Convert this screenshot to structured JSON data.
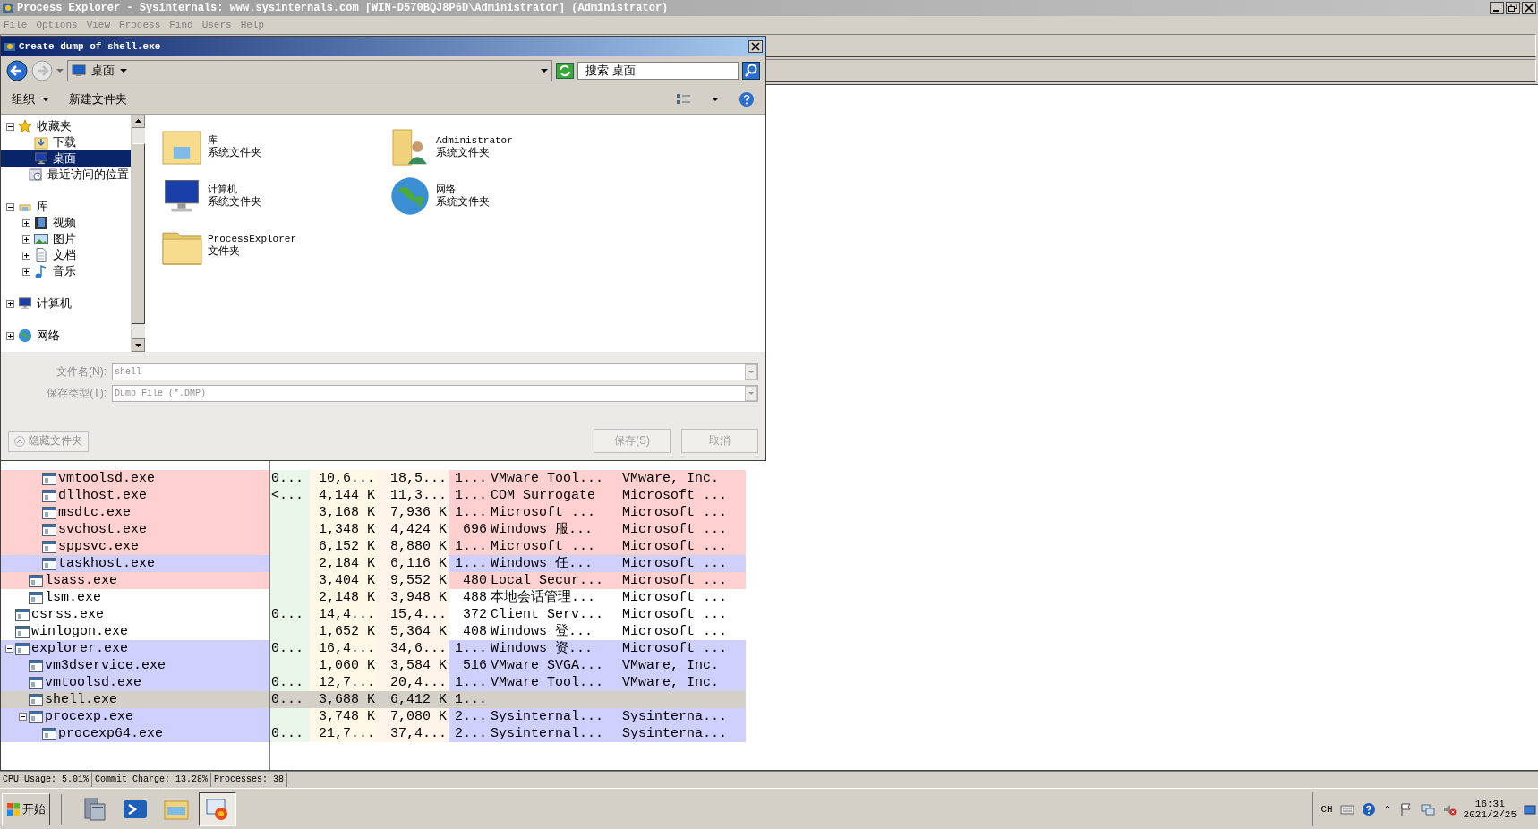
{
  "window": {
    "title": "Process Explorer - Sysinternals: www.sysinternals.com [WIN-D570BQJ8P6D\\Administrator] (Administrator)"
  },
  "menu": [
    "File",
    "Options",
    "View",
    "Process",
    "Find",
    "Users",
    "Help"
  ],
  "processes": [
    {
      "children": [
        {
          "children": [
            {
              "name": "vmtoolsd.exe",
              "cells": [
                "0...",
                "10,6...",
                "18,5...",
                "1...",
                "VMware Tool...",
                "VMware, Inc."
              ],
              "color": "#ffd0d0",
              "selected": false
            },
            {
              "name": "dllhost.exe",
              "cells": [
                "<...",
                "4,144 K",
                "11,3...",
                "1...",
                "COM Surrogate",
                "Microsoft ..."
              ],
              "color": "#ffd0d0",
              "selected": false
            },
            {
              "name": "msdtc.exe",
              "cells": [
                "",
                "3,168 K",
                "7,936 K",
                "1...",
                "Microsoft ...",
                "Microsoft ..."
              ],
              "color": "#ffd0d0",
              "selected": false
            },
            {
              "name": "svchost.exe",
              "cells": [
                "",
                "1,348 K",
                "4,424 K",
                "696",
                "Windows 服...",
                "Microsoft ..."
              ],
              "color": "#ffd0d0",
              "selected": false
            },
            {
              "name": "sppsvc.exe",
              "cells": [
                "",
                "6,152 K",
                "8,880 K",
                "1...",
                "Microsoft ...",
                "Microsoft ..."
              ],
              "color": "#ffd0d0",
              "selected": false
            },
            {
              "name": "taskhost.exe",
              "cells": [
                "",
                "2,184 K",
                "6,116 K",
                "1...",
                "Windows 任...",
                "Microsoft ..."
              ],
              "color": "#d0d0ff",
              "selected": false
            }
          ]
        },
        {
          "name": "lsass.exe",
          "cells": [
            "",
            "3,404 K",
            "9,552 K",
            "480",
            "Local Secur...",
            "Microsoft ..."
          ],
          "color": "#ffd0d0",
          "selected": false
        },
        {
          "name": "lsm.exe",
          "cells": [
            "",
            "2,148 K",
            "3,948 K",
            "488",
            "本地会话管理...",
            "Microsoft ..."
          ],
          "color": "#ffffff",
          "selected": false
        }
      ]
    },
    {
      "name": "csrss.exe",
      "cells": [
        "0...",
        "14,4...",
        "15,4...",
        "372",
        "Client Serv...",
        "Microsoft ..."
      ],
      "color": "#ffffff",
      "selected": false
    },
    {
      "name": "winlogon.exe",
      "cells": [
        "",
        "1,652 K",
        "5,364 K",
        "408",
        "Windows 登...",
        "Microsoft ..."
      ],
      "color": "#ffffff",
      "selected": false
    },
    {
      "name": "explorer.exe",
      "cells": [
        "0...",
        "16,4...",
        "34,6...",
        "1...",
        "Windows 资...",
        "Microsoft ..."
      ],
      "color": "#d0d0ff",
      "selected": false,
      "expanded": true,
      "children": [
        {
          "name": "vm3dservice.exe",
          "cells": [
            "",
            "1,060 K",
            "3,584 K",
            "516",
            "VMware SVGA...",
            "VMware, Inc."
          ],
          "color": "#d0d0ff",
          "selected": false
        },
        {
          "name": "vmtoolsd.exe",
          "cells": [
            "0...",
            "12,7...",
            "20,4...",
            "1...",
            "VMware Tool...",
            "VMware, Inc."
          ],
          "color": "#d0d0ff",
          "selected": false
        },
        {
          "name": "shell.exe",
          "cells": [
            "0...",
            "3,688 K",
            "6,412 K",
            "1..."
          ],
          "selected": true
        },
        {
          "name": "procexp.exe",
          "cells": [
            "",
            "3,748 K",
            "7,080 K",
            "2...",
            "Sysinternal...",
            "Sysinterna..."
          ],
          "color": "#d0d0ff",
          "selected": false,
          "expanded": true,
          "children": [
            {
              "name": "procexp64.exe",
              "cells": [
                "0...",
                "21,7...",
                "37,4...",
                "2...",
                "Sysinternal...",
                "Sysinterna..."
              ],
              "color": "#d0d0ff",
              "selected": false
            }
          ]
        }
      ]
    }
  ],
  "status_bar": [
    "CPU Usage: 5.01%",
    "Commit Charge: 13.28%",
    "Processes: 38"
  ],
  "dialog": {
    "title": "Create dump of shell.exe",
    "address": "桌面",
    "search_placeholder": "搜索 桌面",
    "toolbar": [
      "组织",
      "新建文件夹"
    ],
    "nav": [
      {
        "label": "收藏夹",
        "expanded": true,
        "selected": false,
        "children": [
          {
            "label": "下载",
            "selected": false
          },
          {
            "label": "桌面",
            "selected": true
          },
          {
            "label": "最近访问的位置",
            "selected": false
          }
        ]
      },
      {
        "label": "库",
        "expanded": true,
        "selected": false,
        "children": [
          {
            "label": "视频",
            "expanded": false,
            "selected": false
          },
          {
            "label": "图片",
            "expanded": false,
            "selected": false
          },
          {
            "label": "文档",
            "expanded": false,
            "selected": false
          },
          {
            "label": "音乐",
            "expanded": false,
            "selected": false
          }
        ]
      },
      {
        "label": "计算机",
        "expanded": false,
        "selected": false
      },
      {
        "label": "网络",
        "expanded": false,
        "selected": false
      }
    ],
    "items": [
      {
        "name": "库",
        "type": "系统文件夹"
      },
      {
        "name": "Administrator",
        "type": "系统文件夹"
      },
      {
        "name": "计算机",
        "type": "系统文件夹"
      },
      {
        "name": "网络",
        "type": "系统文件夹"
      },
      {
        "name": "ProcessExplorer",
        "type": "文件夹"
      }
    ],
    "file_name": {
      "label": "文件名(N):",
      "value": "shell"
    },
    "file_type": {
      "label": "保存类型(T):",
      "value": "Dump File (*.DMP)"
    },
    "hide_folders": "隐藏文件夹",
    "buttons": [
      {
        "label": "保存(S)",
        "disabled": true
      },
      {
        "label": "取消",
        "disabled": true
      }
    ]
  },
  "taskbar": {
    "start": "开始",
    "apps": [
      {
        "selected": false
      },
      {
        "selected": false
      },
      {
        "selected": false
      },
      {
        "selected": true
      }
    ],
    "language": "CH",
    "time": "16:31",
    "date": "2021/2/25"
  }
}
